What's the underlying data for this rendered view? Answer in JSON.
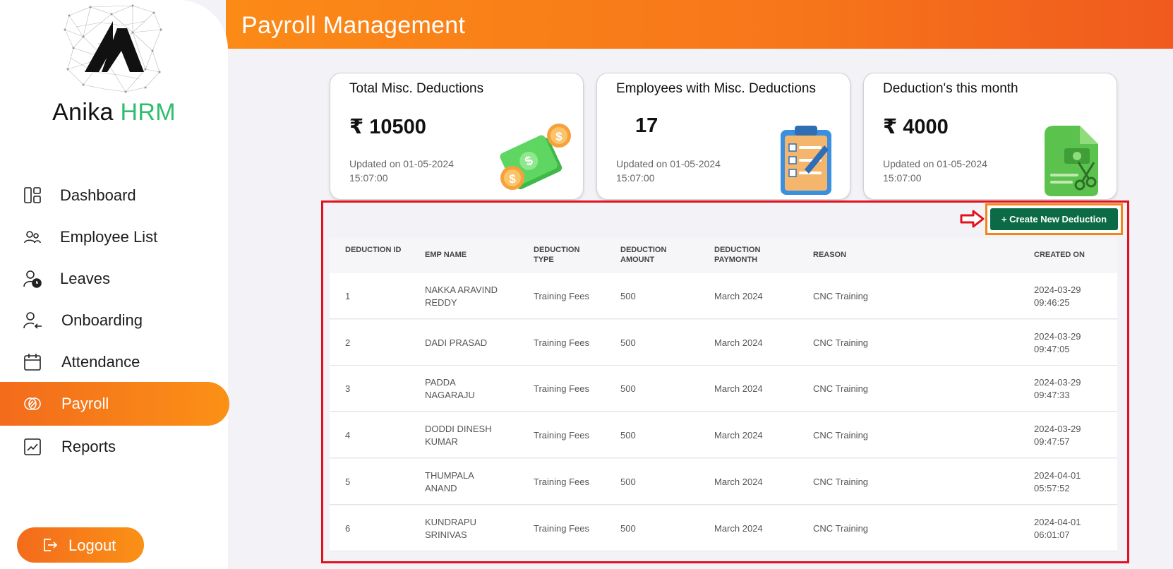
{
  "brand": {
    "name_a": "Anika",
    "name_b": "HRM"
  },
  "nav": [
    {
      "label": "Dashboard",
      "icon": "dashboard-icon"
    },
    {
      "label": "Employee List",
      "icon": "users-icon"
    },
    {
      "label": "Leaves",
      "icon": "user-clock-icon"
    },
    {
      "label": "Onboarding",
      "icon": "user-arrow-icon"
    },
    {
      "label": "Attendance",
      "icon": "calendar-icon"
    },
    {
      "label": "Payroll",
      "icon": "payroll-icon"
    },
    {
      "label": "Reports",
      "icon": "report-chart-icon"
    }
  ],
  "logout_label": "Logout",
  "header": {
    "title": "Payroll Management"
  },
  "cards": [
    {
      "title": "Total Misc. Deductions",
      "value": "₹ 10500",
      "updated": "Updated on 01-05-2024 15:07:00",
      "icon": "money-icon"
    },
    {
      "title": "Employees with Misc. Deductions",
      "value": "17",
      "updated": "Updated on 01-05-2024 15:07:00",
      "icon": "clipboard-icon"
    },
    {
      "title": "Deduction's this month",
      "value": "₹ 4000",
      "updated": "Updated on 01-05-2024 15:07:00",
      "icon": "invoice-icon"
    }
  ],
  "create_button": "+ Create New Deduction",
  "table": {
    "headers": [
      "DEDUCTION ID",
      "EMP NAME",
      "DEDUCTION TYPE",
      "DEDUCTION AMOUNT",
      "DEDUCTION PAYMONTH",
      "REASON",
      "CREATED ON"
    ],
    "rows": [
      {
        "id": "1",
        "name": "NAKKA ARAVIND REDDY",
        "type": "Training Fees",
        "amount": "500",
        "paymonth": "March 2024",
        "reason": "CNC Training",
        "created": "2024-03-29 09:46:25"
      },
      {
        "id": "2",
        "name": "DADI PRASAD",
        "type": "Training Fees",
        "amount": "500",
        "paymonth": "March 2024",
        "reason": "CNC Training",
        "created": "2024-03-29 09:47:05"
      },
      {
        "id": "3",
        "name": "PADDA NAGARAJU",
        "type": "Training Fees",
        "amount": "500",
        "paymonth": "March 2024",
        "reason": "CNC Training",
        "created": "2024-03-29 09:47:33"
      },
      {
        "id": "4",
        "name": "DODDI DINESH KUMAR",
        "type": "Training Fees",
        "amount": "500",
        "paymonth": "March 2024",
        "reason": "CNC Training",
        "created": "2024-03-29 09:47:57"
      },
      {
        "id": "5",
        "name": "THUMPALA ANAND",
        "type": "Training Fees",
        "amount": "500",
        "paymonth": "March 2024",
        "reason": "CNC Training",
        "created": "2024-04-01 05:57:52"
      },
      {
        "id": "6",
        "name": "KUNDRAPU SRINIVAS",
        "type": "Training Fees",
        "amount": "500",
        "paymonth": "March 2024",
        "reason": "CNC Training",
        "created": "2024-04-01 06:01:07"
      }
    ]
  },
  "colors": {
    "accent_orange": "#f7761a",
    "brand_green": "#2fbd70",
    "button_green": "#0c6b47",
    "highlight_red": "#e3101e"
  }
}
